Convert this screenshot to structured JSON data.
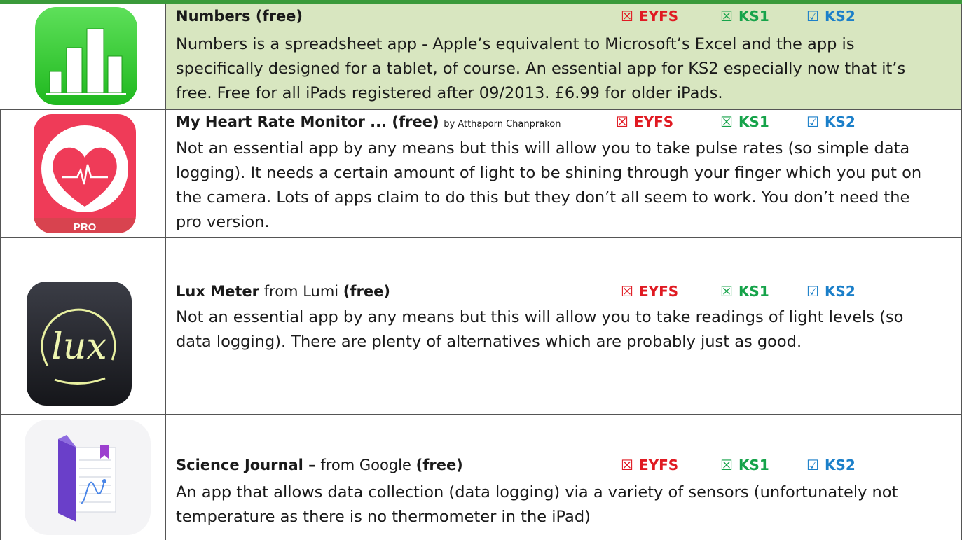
{
  "apps": [
    {
      "title_bold": "Numbers (free)",
      "title_normal": "",
      "byline": "",
      "eyfs": "EYFS",
      "ks1": "KS1",
      "ks2": "KS2",
      "eyfs_mark": "☒",
      "ks1_mark": "☒",
      "ks2_mark": "☑",
      "description": "Numbers is a spreadsheet app - Apple’s equivalent to Microsoft’s Excel and the app is specifically designed for a tablet, of course. An essential app for KS2 especially now that it’s free. Free for all iPads registered after 09/2013. £6.99 for older iPads.",
      "icon": "numbers-app-icon"
    },
    {
      "title_bold": "My Heart Rate Monitor ... (free)",
      "title_normal": "",
      "byline": "by Atthaporn Chanprakon",
      "eyfs": "EYFS",
      "ks1": "KS1",
      "ks2": "KS2",
      "eyfs_mark": "☒",
      "ks1_mark": "☒",
      "ks2_mark": "☑",
      "description": "Not an essential app by any means but this will allow you to take pulse rates (so simple data logging). It needs a certain amount of light to be shining through your finger which you put on the camera. Lots of apps claim to do this but they don’t all seem to work. You don’t need the pro version.",
      "icon": "heart-rate-app-icon",
      "icon_label": "PRO"
    },
    {
      "title_bold": "Lux Meter",
      "title_normal": " from Lumi ",
      "title_bold2": "(free)",
      "byline": "",
      "eyfs": "EYFS",
      "ks1": "KS1",
      "ks2": "KS2",
      "eyfs_mark": "☒",
      "ks1_mark": "☒",
      "ks2_mark": "☑",
      "description": "Not an essential app by any means but this will allow you to take readings of light levels (so data logging). There are plenty of alternatives which are probably just as good.",
      "icon": "lux-meter-app-icon"
    },
    {
      "title_bold": "Science Journal –",
      "title_normal": " from Google ",
      "title_bold2": "(free)",
      "byline": "",
      "eyfs": "EYFS",
      "ks1": "KS1",
      "ks2": "KS2",
      "eyfs_mark": "☒",
      "ks1_mark": "☒",
      "ks2_mark": "☑",
      "description": "An app that allows data collection (data logging) via a variety of sensors (unfortunately not temperature as there is no thermometer in the iPad)",
      "icon": "science-journal-app-icon"
    }
  ],
  "colors": {
    "header_row_bg": "#d8e6c0",
    "eyfs": "#e01a22",
    "ks1": "#16a34a",
    "ks2": "#1b7fc9",
    "border": "#555555",
    "top_rule": "#3a9a3a"
  }
}
